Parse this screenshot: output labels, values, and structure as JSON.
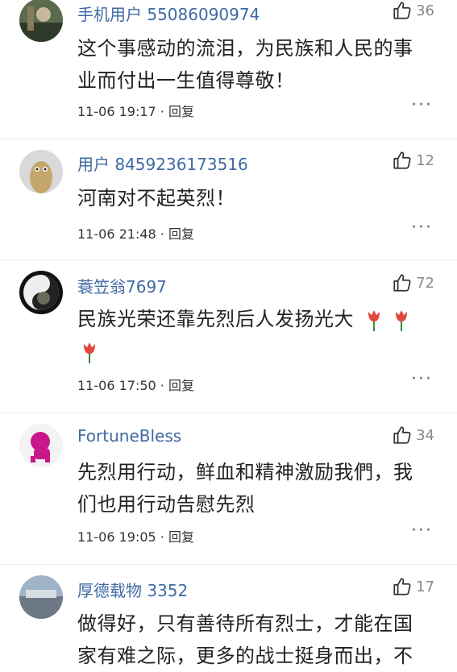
{
  "comments": [
    {
      "username": "手机用户 55086090974",
      "likes": "36",
      "lines": [
        "这个事感动的流泪，为民族和人民的事",
        "业而付出一生值得尊敬！"
      ],
      "time": "11-06 19:17",
      "reply": "回复",
      "more": "···"
    },
    {
      "username": "用户 8459236173516",
      "likes": "12",
      "lines": [
        "河南对不起英烈！"
      ],
      "time": "11-06 21:48",
      "reply": "回复",
      "more": "···"
    },
    {
      "username": "蓑笠翁7697",
      "likes": "72",
      "lines": [
        "民族光荣还靠先烈后人发扬光大"
      ],
      "emoji": "tulip-emoji",
      "time": "11-06 17:50",
      "reply": "回复",
      "more": "···"
    },
    {
      "username": "FortuneBless",
      "likes": "34",
      "lines": [
        "先烈用行动，鲜血和精神激励我們，我",
        "们也用行动告慰先烈"
      ],
      "time": "11-06 19:05",
      "reply": "回复",
      "more": "···"
    },
    {
      "username": "厚德载物 3352",
      "likes": "17",
      "lines": [
        "做得好，只有善待所有烈士，才能在国",
        "家有难之际，更多的战士挺身而出，不"
      ],
      "time": "",
      "reply": "",
      "more": ""
    }
  ],
  "separator": " · ",
  "colors": {
    "username": "#3f6aa3",
    "text": "#222222",
    "meta": "#333333",
    "like": "#888888"
  }
}
